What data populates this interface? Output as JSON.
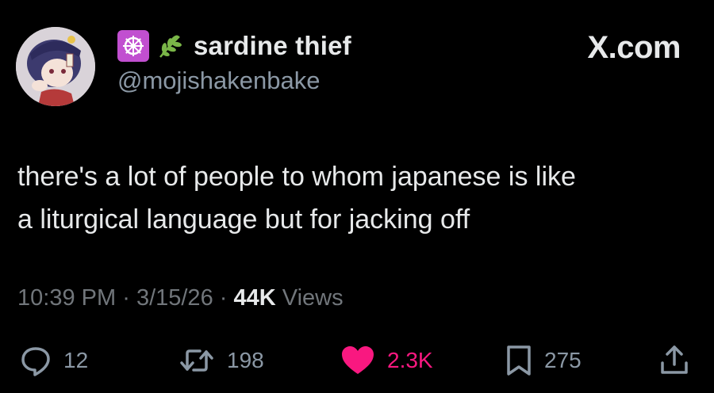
{
  "author": {
    "display_name": "sardine thief",
    "handle": "@mojishakenbake",
    "badges": [
      "dharma-wheel-icon",
      "herb-icon"
    ],
    "avatar": "anime-character-avatar"
  },
  "brand": "X.com",
  "tweet": {
    "text_line1": "there's a lot of people to whom japanese is like",
    "text_line2": "a liturgical language but for jacking off"
  },
  "meta": {
    "time": "10:39 PM",
    "date": "3/15/26",
    "views_count": "44K",
    "views_label": "Views",
    "separator": "·"
  },
  "actions": {
    "replies": "12",
    "reposts": "198",
    "likes": "2.3K",
    "bookmarks": "275"
  },
  "colors": {
    "background": "#000000",
    "text": "#e7e9ea",
    "secondary": "#71767b",
    "like": "#f91880",
    "badge": "#c14fd0",
    "herb": "#7ab648"
  }
}
